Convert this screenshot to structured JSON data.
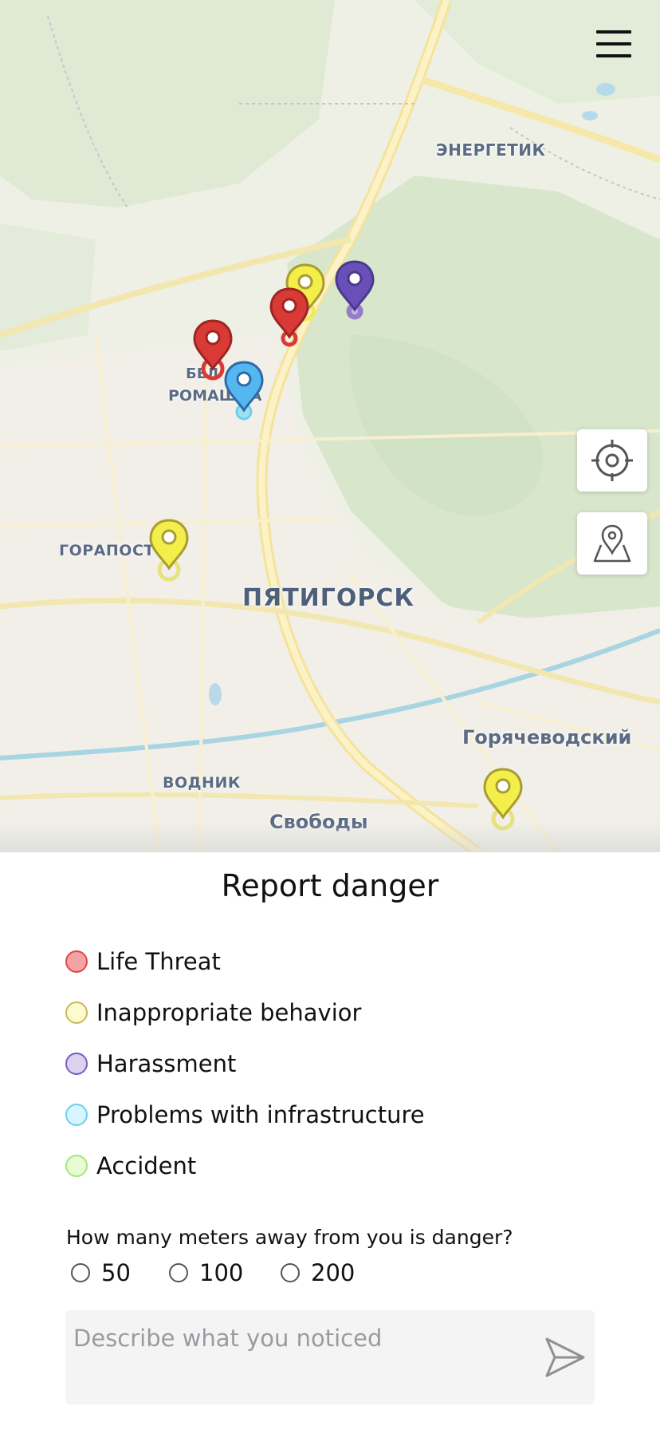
{
  "map": {
    "labels": {
      "energetik": "ЭНЕРГЕТИК",
      "gorapost": "ГОРАПОСТ",
      "pyatigorsk": "ПЯТИГОРСК",
      "goryachevodsky": "Горячеводский",
      "vodnik": "ВОДНИК",
      "svobody": "Свободы",
      "bely": "БЕЛ",
      "romashka": "РОМАШКА"
    },
    "markers": [
      {
        "category": "Inappropriate behavior",
        "color": "#f0ea3c"
      },
      {
        "category": "Harassment",
        "color": "#6a4fb8"
      },
      {
        "category": "Life Threat",
        "color": "#d93a35"
      },
      {
        "category": "Life Threat",
        "color": "#d93a35"
      },
      {
        "category": "Problems with infrastructure",
        "color": "#55b7ef"
      },
      {
        "category": "Inappropriate behavior",
        "color": "#f0ea3c"
      },
      {
        "category": "Inappropriate behavior",
        "color": "#f0ea3c"
      }
    ],
    "controls": {
      "menu_icon": "hamburger-menu-icon",
      "locate_icon": "crosshair-target-icon",
      "pin_icon": "map-pin-icon"
    }
  },
  "panel": {
    "title": "Report danger",
    "categories": [
      {
        "label": "Life Threat",
        "fill": "#f4a3a3",
        "border": "#e04848"
      },
      {
        "label": "Inappropriate behavior",
        "fill": "#fdfad0",
        "border": "#c8b95a"
      },
      {
        "label": "Harassment",
        "fill": "#dcd2f0",
        "border": "#7a5cc0"
      },
      {
        "label": "Problems with infrastructure",
        "fill": "#d8f4fc",
        "border": "#6cd0ee"
      },
      {
        "label": "Accident",
        "fill": "#e6fbd6",
        "border": "#a6e67a"
      }
    ],
    "distance_question": "How many meters away from you is danger?",
    "distance_options": [
      "50",
      "100",
      "200"
    ],
    "description_placeholder": "Describe what you noticed",
    "send_icon": "send-arrow-icon"
  }
}
